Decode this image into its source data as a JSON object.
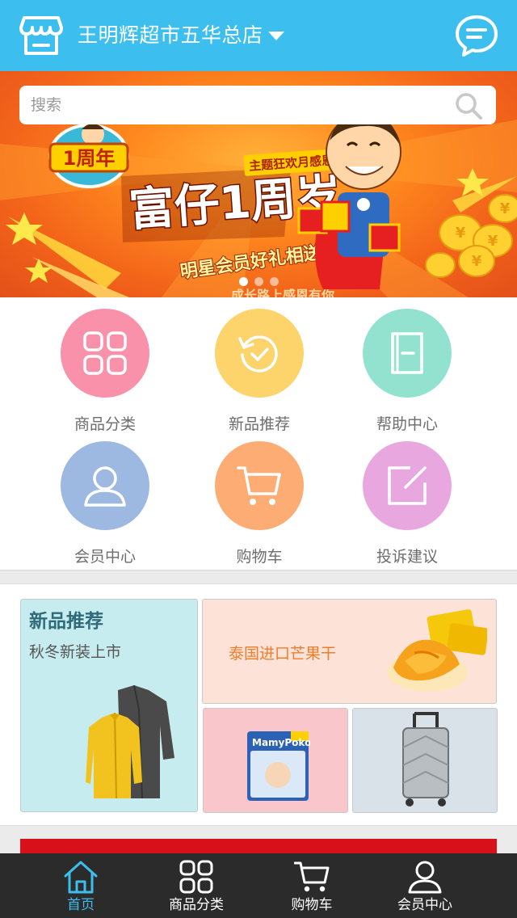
{
  "header": {
    "store_name": "王明辉超市五华总店",
    "store_icon": "store-icon",
    "dropdown_icon": "chevron-down-icon",
    "message_icon": "chat-icon",
    "bg_color": "#3cbfee"
  },
  "search": {
    "placeholder": "搜索",
    "icon": "search-icon"
  },
  "banner": {
    "badge": "1周年",
    "headline": "富仔1周岁",
    "theme": "主题狂欢月感恩篇",
    "subline": "明星会员好礼相送",
    "footer": "成长路上感恩有你",
    "slides": 3,
    "active_slide": 1
  },
  "quick_menu": [
    {
      "label": "商品分类",
      "icon": "grid-icon",
      "color": "#f891a9"
    },
    {
      "label": "新品推荐",
      "icon": "refresh-check-icon",
      "color": "#fcd46b"
    },
    {
      "label": "帮助中心",
      "icon": "book-icon",
      "color": "#93e2d0"
    },
    {
      "label": "会员中心",
      "icon": "user-icon",
      "color": "#9db9e2"
    },
    {
      "label": "购物车",
      "icon": "cart-icon",
      "color": "#fdac73"
    },
    {
      "label": "投诉建议",
      "icon": "edit-icon",
      "color": "#e9a7e0"
    }
  ],
  "promo": {
    "new_title": "新品推荐",
    "new_subtitle": "秋冬新装上市",
    "mango_text": "泰国进口芒果干",
    "diaper_brand": "MamyPoko"
  },
  "bottom_nav": [
    {
      "label": "首页",
      "icon": "home-icon",
      "active": true
    },
    {
      "label": "商品分类",
      "icon": "grid-icon",
      "active": false
    },
    {
      "label": "购物车",
      "icon": "cart-icon",
      "active": false
    },
    {
      "label": "会员中心",
      "icon": "user-icon",
      "active": false
    }
  ]
}
